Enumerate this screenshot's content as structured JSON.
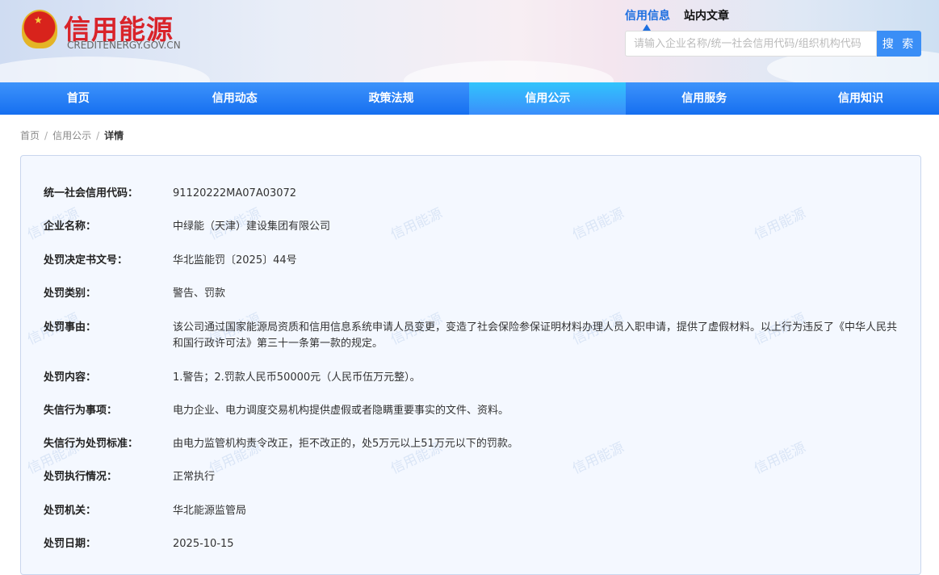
{
  "header": {
    "logo_title": "信用能源",
    "logo_sub": "CREDITENERGY.GOV.CN",
    "search_tabs": [
      "信用信息",
      "站内文章"
    ],
    "search_placeholder": "请输入企业名称/统一社会信用代码/组织机构代码",
    "search_button": "搜 索"
  },
  "nav": [
    "首页",
    "信用动态",
    "政策法规",
    "信用公示",
    "信用服务",
    "信用知识"
  ],
  "breadcrumb": [
    "首页",
    "信用公示",
    "详情"
  ],
  "watermark": "信用能源",
  "details": [
    {
      "label": "统一社会信用代码：",
      "value": "91120222MA07A03072"
    },
    {
      "label": "企业名称：",
      "value": "中绿能（天津）建设集团有限公司"
    },
    {
      "label": "处罚决定书文号：",
      "value": "华北监能罚〔2025〕44号"
    },
    {
      "label": "处罚类别：",
      "value": "警告、罚款"
    },
    {
      "label": "处罚事由：",
      "value": "该公司通过国家能源局资质和信用信息系统申请人员变更，变造了社会保险参保证明材料办理人员入职申请，提供了虚假材料。以上行为违反了《中华人民共和国行政许可法》第三十一条第一款的规定。"
    },
    {
      "label": "处罚内容：",
      "value": "1.警告；2.罚款人民币50000元（人民币伍万元整）。"
    },
    {
      "label": "失信行为事项：",
      "value": "电力企业、电力调度交易机构提供虚假或者隐瞒重要事实的文件、资料。"
    },
    {
      "label": "失信行为处罚标准：",
      "value": "由电力监管机构责令改正，拒不改正的，处5万元以上51万元以下的罚款。"
    },
    {
      "label": "处罚执行情况：",
      "value": "正常执行"
    },
    {
      "label": "处罚机关：",
      "value": "华北能源监管局"
    },
    {
      "label": "处罚日期：",
      "value": "2025-10-15"
    }
  ]
}
